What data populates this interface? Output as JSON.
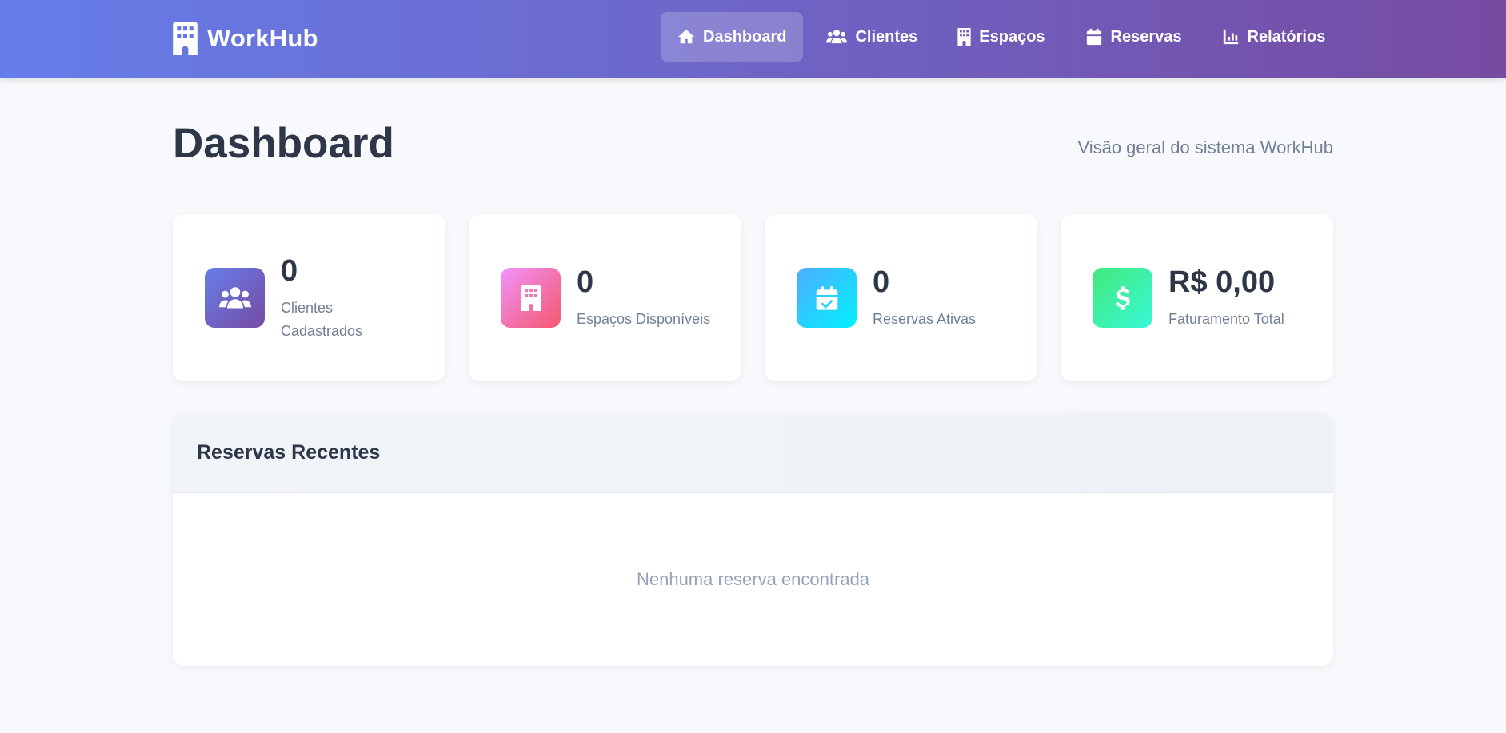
{
  "brand": {
    "name": "WorkHub",
    "icon": "building-icon"
  },
  "nav": {
    "items": [
      {
        "label": "Dashboard",
        "icon": "home-icon",
        "active": true
      },
      {
        "label": "Clientes",
        "icon": "users-icon",
        "active": false
      },
      {
        "label": "Espaços",
        "icon": "building-icon",
        "active": false
      },
      {
        "label": "Reservas",
        "icon": "calendar-icon",
        "active": false
      },
      {
        "label": "Relatórios",
        "icon": "chart-icon",
        "active": false
      }
    ]
  },
  "header": {
    "title": "Dashboard",
    "subtitle": "Visão geral do sistema WorkHub"
  },
  "stats": [
    {
      "value": "0",
      "label": "Clientes Cadastrados",
      "icon": "users-icon",
      "gradient": [
        "#667eea",
        "#764ba2"
      ]
    },
    {
      "value": "0",
      "label": "Espaços Disponíveis",
      "icon": "building-icon",
      "gradient": [
        "#f093fb",
        "#f5576c"
      ]
    },
    {
      "value": "0",
      "label": "Reservas Ativas",
      "icon": "calendar-check-icon",
      "gradient": [
        "#4facfe",
        "#00f2fe"
      ]
    },
    {
      "value": "R$ 0,00",
      "label": "Faturamento Total",
      "icon": "dollar-icon",
      "gradient": [
        "#43e97b",
        "#38f9d7"
      ]
    }
  ],
  "recent": {
    "title": "Reservas Recentes",
    "empty_text": "Nenhuma reserva encontrada"
  },
  "colors": {
    "nav_start": "#667eea",
    "nav_end": "#764ba2",
    "background": "#f7f9fc",
    "text": "#2d3748",
    "muted": "#718096"
  }
}
